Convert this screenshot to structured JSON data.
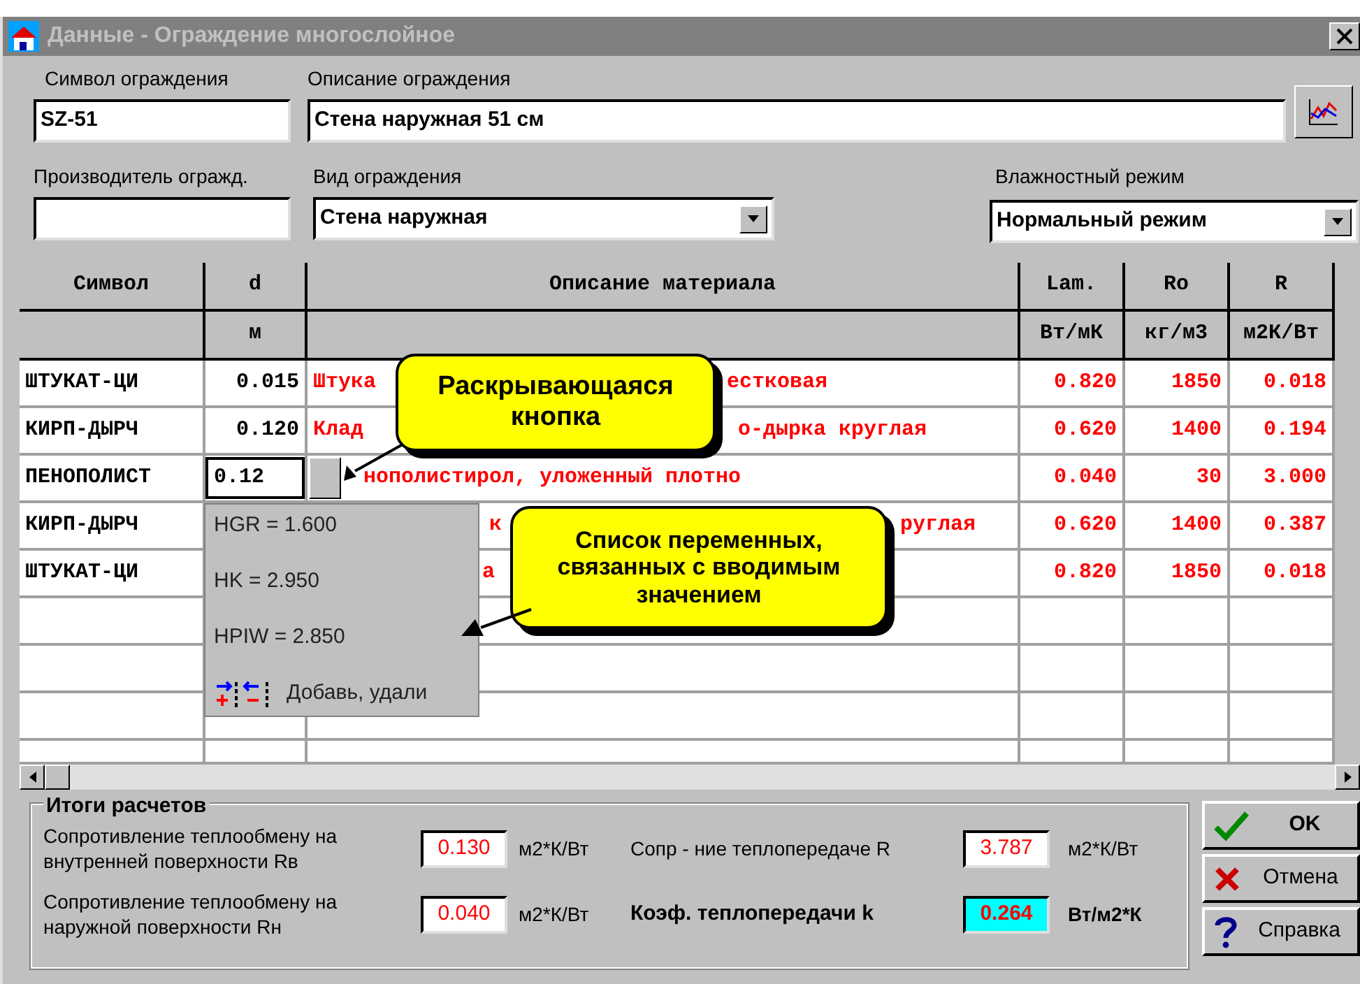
{
  "window": {
    "title": "Данные - Ограждение многослойное"
  },
  "fields": {
    "symbol": {
      "label": "Символ ограждения",
      "value": "SZ-51"
    },
    "description": {
      "label": "Описание ограждения",
      "value": "Стена наружная 51 см"
    },
    "manufacturer": {
      "label": "Производитель огражд."
    },
    "type": {
      "label": "Вид ограждения",
      "value": "Стена наружная"
    },
    "humidity": {
      "label": "Влажностный режим",
      "value": "Нормальный режим"
    }
  },
  "table": {
    "columns": [
      {
        "title": "Символ"
      },
      {
        "title": "d",
        "unit": "м"
      },
      {
        "title": "Описание материала"
      },
      {
        "title": "Lam.",
        "unit": "Вт/мК"
      },
      {
        "title": "Ro",
        "unit": "кг/м3"
      },
      {
        "title": "R",
        "unit": "м2К/Вт"
      }
    ],
    "rows": [
      {
        "symbol": "ШТУКАТ-ЦИ",
        "d": "0.015",
        "editing": false,
        "description_parts": [
          "Штука",
          "естковая"
        ],
        "lam": "0.820",
        "ro": "1850",
        "r": "0.018"
      },
      {
        "symbol": "КИРП-ДЫРЧ",
        "d": "0.120",
        "editing": false,
        "description_parts": [
          "Клад",
          "о-дырка круглая"
        ],
        "lam": "0.620",
        "ro": "1400",
        "r": "0.194"
      },
      {
        "symbol": "ПЕНОПОЛИСТ",
        "d": "0.12",
        "editing": true,
        "description_parts": [
          "нополистирол, уложенный плотно"
        ],
        "lam": "0.040",
        "ro": "30",
        "r": "3.000"
      },
      {
        "symbol": "КИРП-ДЫРЧ",
        "d": "",
        "description_parts": [
          "к",
          "руглая"
        ],
        "lam": "0.620",
        "ro": "1400",
        "r": "0.387"
      },
      {
        "symbol": "ШТУКАТ-ЦИ",
        "d": "",
        "description_parts": [
          "а"
        ],
        "lam": "0.820",
        "ro": "1850",
        "r": "0.018"
      }
    ]
  },
  "dropdown": {
    "items": [
      "HGR = 1.600",
      "HK = 2.950",
      "HPIW = 2.850"
    ],
    "action": "Добавь, удали"
  },
  "callouts": [
    {
      "text": "Раскрывающаяся кнопка"
    },
    {
      "text": "Список переменных, связанных с вводимым значением"
    }
  ],
  "results": {
    "title": "Итоги расчетов",
    "items": [
      {
        "label": "Сопротивление теплообмену на внутренней поверхности Rв",
        "value": "0.130",
        "unit": "м2*К/Вт",
        "highlighted": false
      },
      {
        "label": "Сопр - ние теплопередаче R",
        "value": "3.787",
        "unit": "м2*К/Вт",
        "highlighted": false
      },
      {
        "label": "Сопротивление теплообмену на наружной поверхности Rн",
        "value": "0.040",
        "unit": "м2*К/Вт",
        "highlighted": false
      },
      {
        "label": "Коэф. теплопередачи k",
        "value": "0.264",
        "unit": "Вт/м2*К",
        "highlighted": true
      }
    ]
  },
  "buttons": [
    {
      "label": "OK",
      "kind": "ok"
    },
    {
      "label": "Отмена",
      "kind": "cancel"
    },
    {
      "label": "Справка",
      "kind": "help"
    }
  ]
}
